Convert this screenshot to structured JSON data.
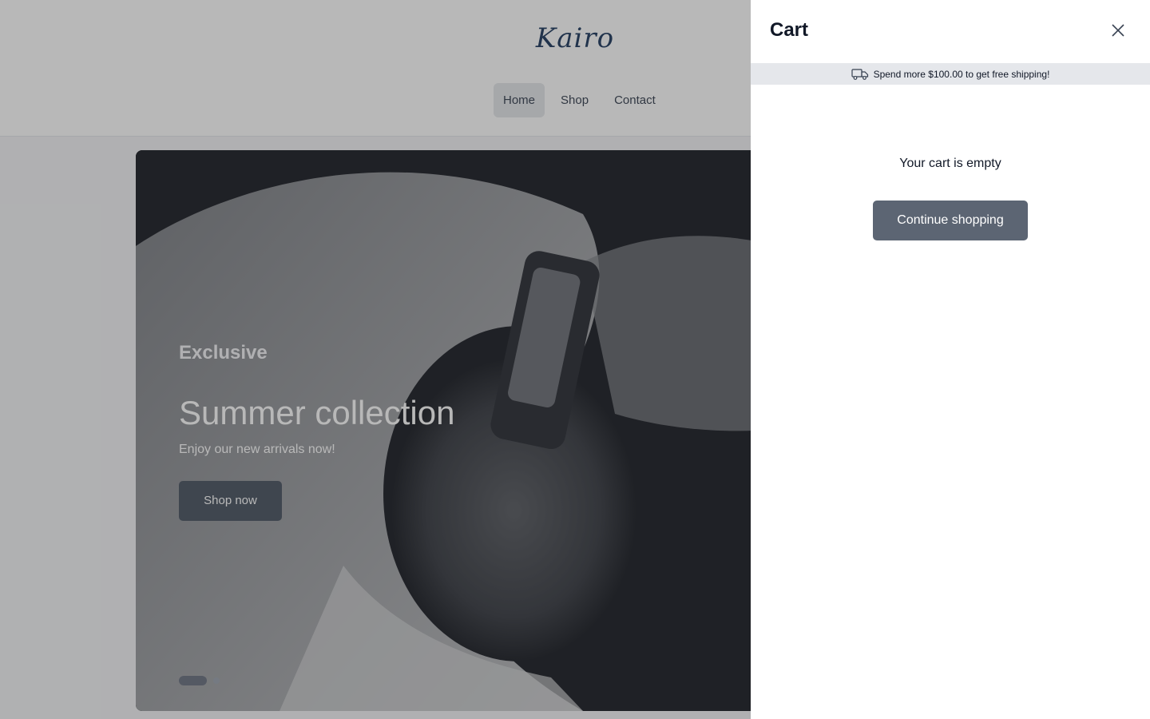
{
  "site": {
    "logo": "Kairo",
    "nav": [
      {
        "label": "Home",
        "active": true
      },
      {
        "label": "Shop",
        "active": false
      },
      {
        "label": "Contact",
        "active": false
      }
    ]
  },
  "hero": {
    "eyebrow": "Exclusive",
    "title": "Summer collection",
    "subtitle": "Enjoy our new arrivals now!",
    "button_label": "Shop now",
    "slides": 2,
    "active_slide": 1
  },
  "cart": {
    "title": "Cart",
    "close_icon": "close-icon",
    "shipping_icon": "truck-icon",
    "shipping_message": "Spend more $100.00 to get free shipping!",
    "empty_message": "Your cart is empty",
    "continue_label": "Continue shopping"
  },
  "colors": {
    "primary_button": "#5c6573",
    "overlay": "rgba(40,40,40,0.33)",
    "shipping_bar": "#e5e7eb"
  }
}
